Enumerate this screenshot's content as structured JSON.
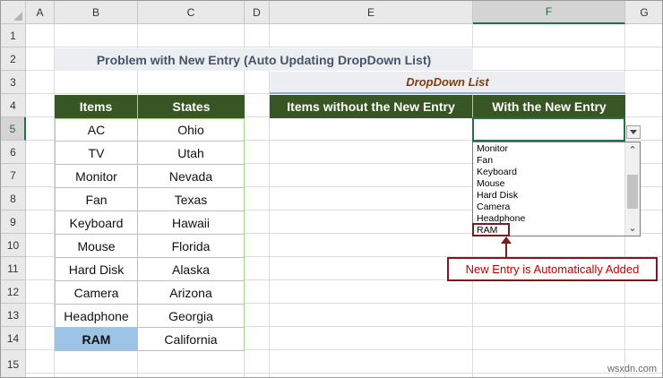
{
  "columns": [
    "A",
    "B",
    "C",
    "D",
    "E",
    "F",
    "G"
  ],
  "selected_column": "F",
  "rows": [
    "1",
    "2",
    "3",
    "4",
    "5",
    "6",
    "7",
    "8",
    "9",
    "10",
    "11",
    "12",
    "13",
    "14",
    "15"
  ],
  "selected_row": "5",
  "sheet": {
    "title": "Problem with New Entry (Auto Updating DropDown List)",
    "dropdown_title": "DropDown List",
    "left_table": {
      "headers": [
        "Items",
        "States"
      ],
      "rows": [
        [
          "AC",
          "Ohio"
        ],
        [
          "TV",
          "Utah"
        ],
        [
          "Monitor",
          "Nevada"
        ],
        [
          "Fan",
          "Texas"
        ],
        [
          "Keyboard",
          "Hawaii"
        ],
        [
          "Mouse",
          "Florida"
        ],
        [
          "Hard Disk",
          "Alaska"
        ],
        [
          "Camera",
          "Arizona"
        ],
        [
          "Headphone",
          "Georgia"
        ],
        [
          "RAM",
          "California"
        ]
      ]
    },
    "right_headers": [
      "Items without the New Entry",
      "With the New Entry"
    ]
  },
  "dropdown": {
    "items": [
      "Monitor",
      "Fan",
      "Keyboard",
      "Mouse",
      "Hard Disk",
      "Camera",
      "Headphone",
      "RAM"
    ],
    "highlighted": "RAM"
  },
  "callout": {
    "text": "New Entry is Automatically Added"
  },
  "watermark": "wsxdn.com",
  "colors": {
    "header_green": "#375623",
    "select_green": "#217346",
    "callout_red": "#7b1c1c",
    "ram_blue": "#9dc3e6"
  }
}
